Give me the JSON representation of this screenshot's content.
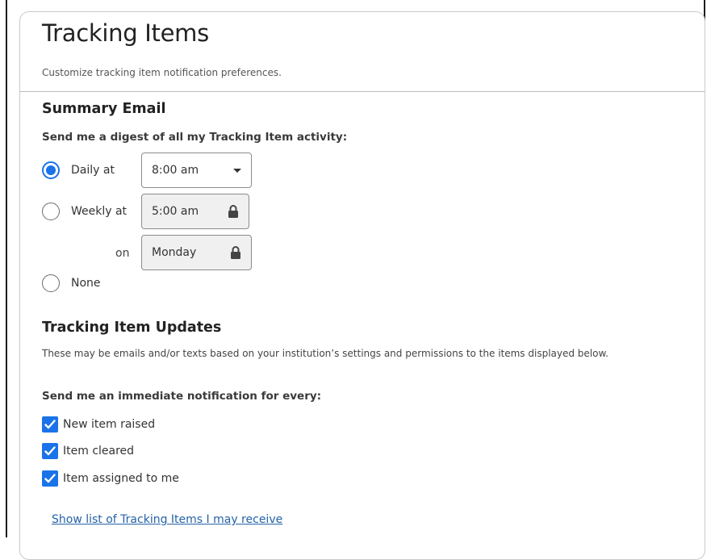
{
  "header": {
    "title": "Tracking Items",
    "subtitle": "Customize tracking item notification preferences."
  },
  "summary": {
    "heading": "Summary Email",
    "prompt": "Send me a digest of all my Tracking Item activity:",
    "options": [
      {
        "label": "Daily at",
        "selected": true
      },
      {
        "label": "Weekly at",
        "selected": false
      },
      {
        "label": "None",
        "selected": false
      }
    ],
    "daily_time": "8:00 am",
    "weekly_time": "5:00 am",
    "on_label": "on",
    "weekly_day": "Monday"
  },
  "updates": {
    "heading": "Tracking Item Updates",
    "description": "These may be emails and/or texts based on your institution’s settings and permissions to the items displayed below.",
    "prompt": "Send me an immediate notification for every:",
    "items": [
      {
        "label": "New item raised",
        "checked": true
      },
      {
        "label": "Item cleared",
        "checked": true
      },
      {
        "label": "Item assigned to me",
        "checked": true
      }
    ],
    "link": "Show list of Tracking Items I may receive"
  },
  "colors": {
    "accent": "#1a73e8",
    "link": "#2563a8",
    "locked_field": "#f0f0f0"
  },
  "icons": [
    "lock-icon",
    "caret-down-icon",
    "checkmark-icon"
  ]
}
